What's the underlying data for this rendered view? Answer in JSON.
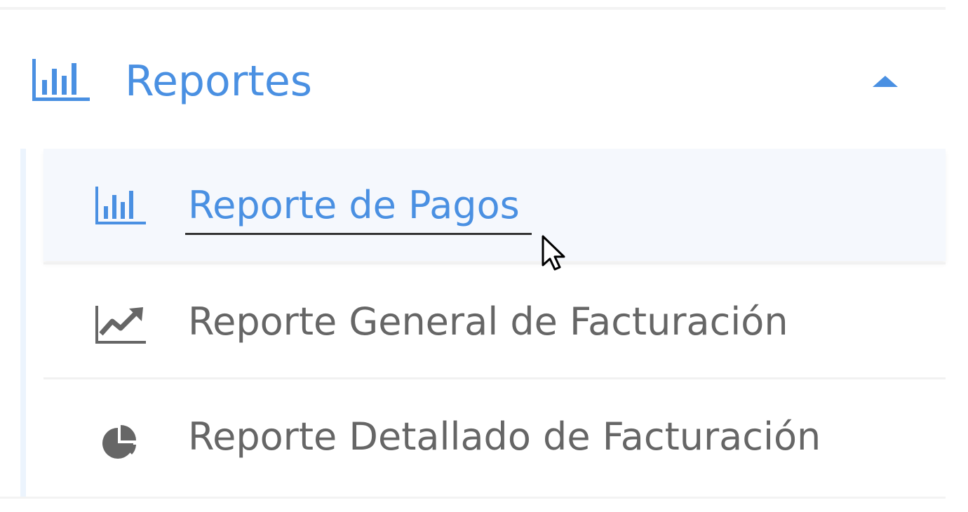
{
  "section": {
    "title": "Reportes",
    "icon": "bar-chart-icon",
    "expanded": true,
    "accent_color": "#4a90e2"
  },
  "items": [
    {
      "label": "Reporte de Pagos",
      "icon": "bar-chart-icon",
      "active": true
    },
    {
      "label": "Reporte General de Facturación",
      "icon": "line-chart-icon",
      "active": false
    },
    {
      "label": "Reporte Detallado de Facturación",
      "icon": "pie-chart-icon",
      "active": false
    }
  ],
  "colors": {
    "active_text": "#4a90e2",
    "inactive_text": "#666666",
    "active_background": "#f5f8fd"
  }
}
